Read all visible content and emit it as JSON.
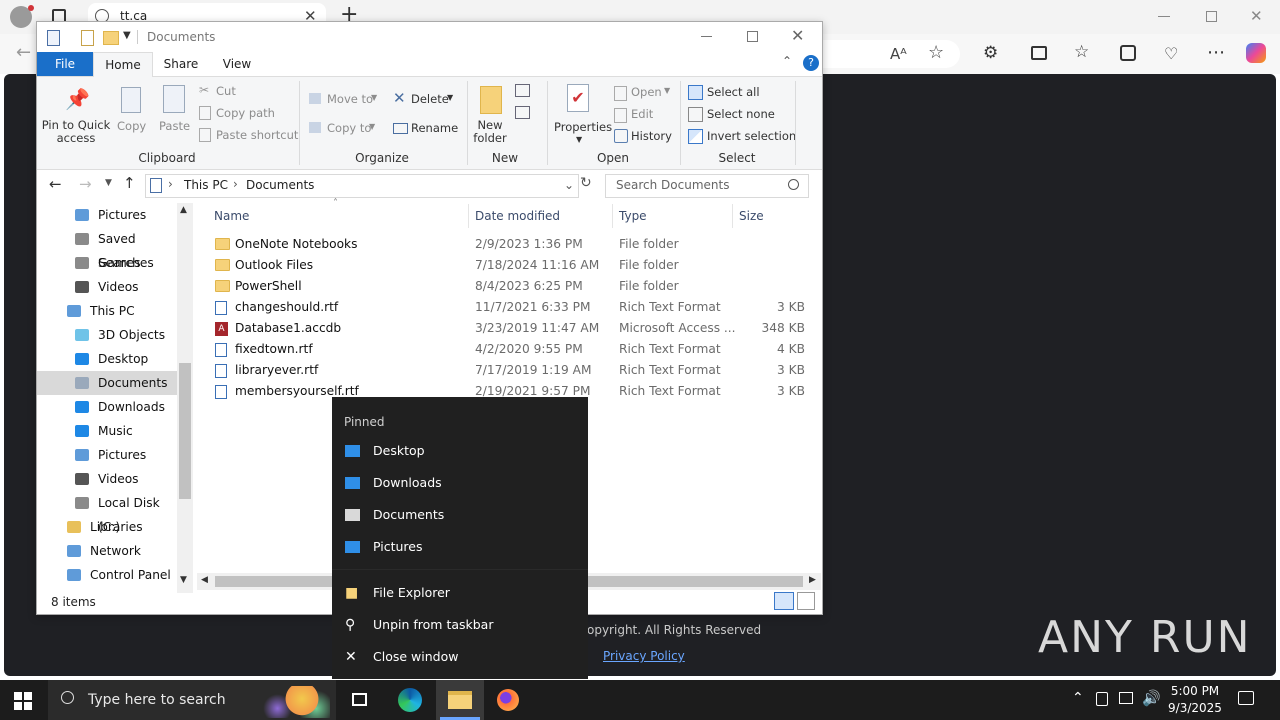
{
  "browser": {
    "tab_title": "tt.ca",
    "new_tab": "+",
    "read_aloud": "Aᴬ"
  },
  "page_footer": {
    "copyright": "opyright. All Rights Reserved",
    "privacy": "Privacy Policy",
    "watermark": "ANY RUN"
  },
  "explorer": {
    "title": "Documents",
    "tabs": [
      "File",
      "Home",
      "Share",
      "View"
    ],
    "ribbon": {
      "clipboard": {
        "pin_line1": "Pin to Quick",
        "pin_line2": "access",
        "copy": "Copy",
        "paste": "Paste",
        "cut": "Cut",
        "copy_path": "Copy path",
        "paste_shortcut": "Paste shortcut",
        "label": "Clipboard"
      },
      "organize": {
        "move_to": "Move to",
        "copy_to": "Copy to",
        "delete": "Delete",
        "rename": "Rename",
        "label": "Organize"
      },
      "new": {
        "folder_line1": "New",
        "folder_line2": "folder",
        "label": "New"
      },
      "open": {
        "properties": "Properties",
        "open": "Open",
        "edit": "Edit",
        "history": "History",
        "label": "Open"
      },
      "select": {
        "select_all": "Select all",
        "select_none": "Select none",
        "invert": "Invert selection",
        "label": "Select"
      }
    },
    "path": [
      "This PC",
      "Documents"
    ],
    "search_placeholder": "Search Documents",
    "tree": [
      {
        "label": "Pictures",
        "icon": "pictures-icon"
      },
      {
        "label": "Saved Games",
        "icon": "saved-games-icon"
      },
      {
        "label": "Searches",
        "icon": "searches-icon"
      },
      {
        "label": "Videos",
        "icon": "videos-icon"
      },
      {
        "label": "This PC",
        "icon": "this-pc-icon"
      },
      {
        "label": "3D Objects",
        "icon": "3d-objects-icon"
      },
      {
        "label": "Desktop",
        "icon": "desktop-icon"
      },
      {
        "label": "Documents",
        "icon": "documents-icon",
        "selected": true
      },
      {
        "label": "Downloads",
        "icon": "downloads-icon"
      },
      {
        "label": "Music",
        "icon": "music-icon"
      },
      {
        "label": "Pictures",
        "icon": "pictures-icon"
      },
      {
        "label": "Videos",
        "icon": "videos-icon"
      },
      {
        "label": "Local Disk (C:)",
        "icon": "disk-icon"
      },
      {
        "label": "Libraries",
        "icon": "libraries-icon"
      },
      {
        "label": "Network",
        "icon": "network-icon"
      },
      {
        "label": "Control Panel",
        "icon": "control-panel-icon"
      }
    ],
    "columns": [
      "Name",
      "Date modified",
      "Type",
      "Size"
    ],
    "files": [
      {
        "name": "OneNote Notebooks",
        "date": "2/9/2023 1:36 PM",
        "type": "File folder",
        "size": "",
        "kind": "folder"
      },
      {
        "name": "Outlook Files",
        "date": "7/18/2024 11:16 AM",
        "type": "File folder",
        "size": "",
        "kind": "folder"
      },
      {
        "name": "PowerShell",
        "date": "8/4/2023 6:25 PM",
        "type": "File folder",
        "size": "",
        "kind": "folder"
      },
      {
        "name": "changeshould.rtf",
        "date": "11/7/2021 6:33 PM",
        "type": "Rich Text Format",
        "size": "3 KB",
        "kind": "rtf"
      },
      {
        "name": "Database1.accdb",
        "date": "3/23/2019 11:47 AM",
        "type": "Microsoft Access ...",
        "size": "348 KB",
        "kind": "access"
      },
      {
        "name": "fixedtown.rtf",
        "date": "4/2/2020 9:55 PM",
        "type": "Rich Text Format",
        "size": "4 KB",
        "kind": "rtf"
      },
      {
        "name": "libraryever.rtf",
        "date": "7/17/2019 1:19 AM",
        "type": "Rich Text Format",
        "size": "3 KB",
        "kind": "rtf"
      },
      {
        "name": "membersyourself.rtf",
        "date": "2/19/2021 9:57 PM",
        "type": "Rich Text Format",
        "size": "3 KB",
        "kind": "rtf"
      }
    ],
    "status": "8 items"
  },
  "jumplist": {
    "header": "Pinned",
    "pinned": [
      "Desktop",
      "Downloads",
      "Documents",
      "Pictures"
    ],
    "actions": [
      "File Explorer",
      "Unpin from taskbar",
      "Close window"
    ]
  },
  "taskbar": {
    "search_placeholder": "Type here to search",
    "time": "5:00 PM",
    "date": "9/3/2025"
  },
  "colors": {
    "accent": "#1a6fc9",
    "menu_bg": "#202020",
    "taskbar_bg": "#1c1c1c"
  }
}
